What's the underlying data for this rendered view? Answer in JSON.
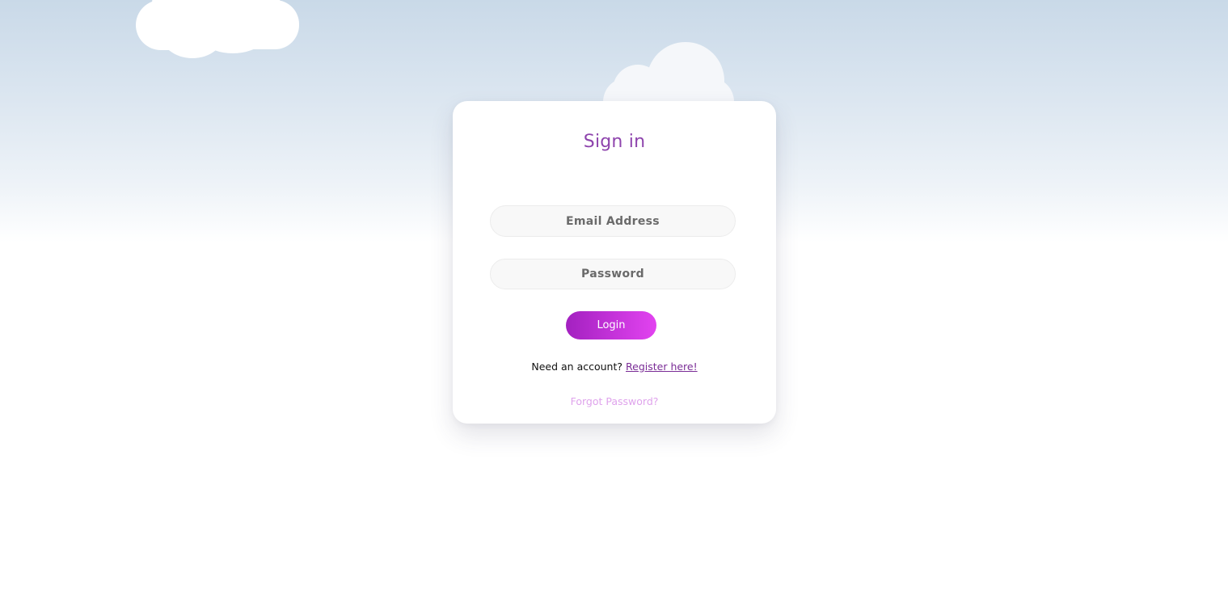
{
  "colors": {
    "title": "#8e44ad",
    "button_gradient_start": "#a321c0",
    "button_gradient_end": "#e243f0",
    "link": "#7a2c96",
    "forgot_link": "#dfa3ec",
    "sky_top": "#c9d9e8"
  },
  "login_card": {
    "title": "Sign in",
    "email": {
      "placeholder": "Email Address",
      "value": ""
    },
    "password": {
      "placeholder": "Password",
      "value": ""
    },
    "login_label": "Login",
    "register_prompt": "Need an account?",
    "register_link": "Register here!",
    "forgot_link": "Forgot Password?"
  }
}
